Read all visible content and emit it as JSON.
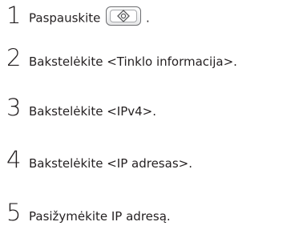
{
  "steps": [
    {
      "number": "1",
      "text_before": "Paspauskite",
      "text_after": ".",
      "icon": "settings-menu-button-icon"
    },
    {
      "number": "2",
      "text": "Bakstelėkite <Tinklo informacija>."
    },
    {
      "number": "3",
      "text": "Bakstelėkite <IPv4>."
    },
    {
      "number": "4",
      "text": "Bakstelėkite <IP adresas>."
    },
    {
      "number": "5",
      "text": "Pasižymėkite IP adresą."
    }
  ]
}
